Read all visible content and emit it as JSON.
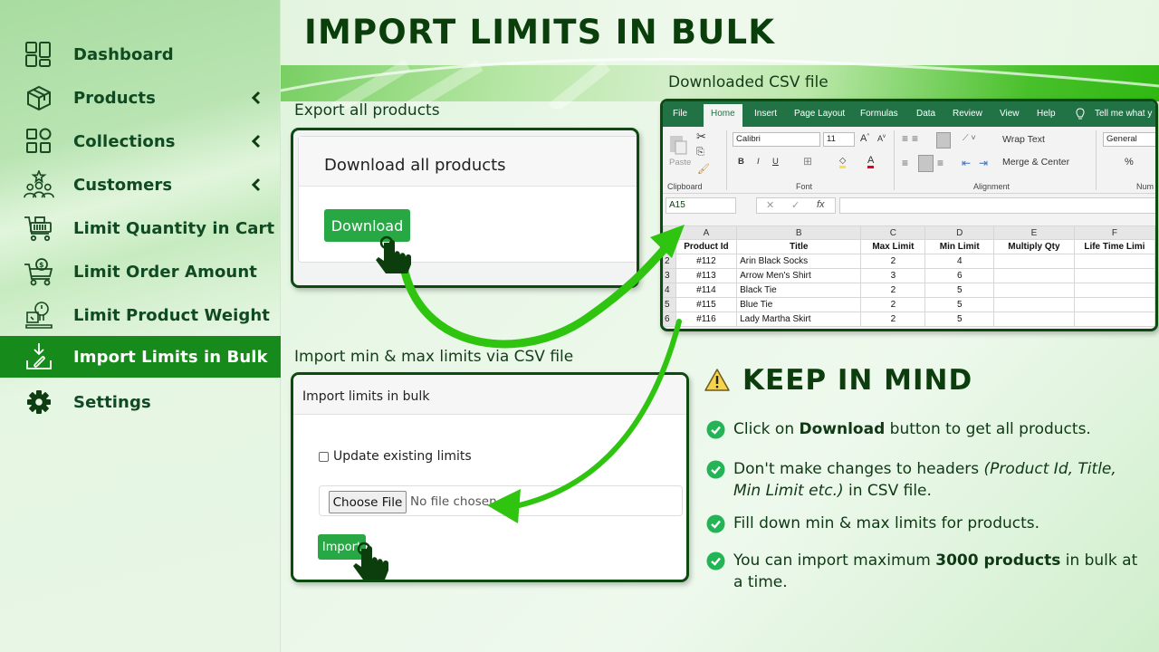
{
  "sidebar": {
    "items": [
      {
        "label": "Dashboard",
        "icon": "dashboard-icon",
        "has_chevron": false,
        "active": false
      },
      {
        "label": "Products",
        "icon": "box-icon",
        "has_chevron": true,
        "active": false
      },
      {
        "label": "Collections",
        "icon": "collections-icon",
        "has_chevron": true,
        "active": false
      },
      {
        "label": "Customers",
        "icon": "customers-icon",
        "has_chevron": true,
        "active": false
      },
      {
        "label": "Limit Quantity in Cart",
        "icon": "cart-icon",
        "has_chevron": false,
        "active": false
      },
      {
        "label": "Limit Order Amount",
        "icon": "cart-dollar-icon",
        "has_chevron": false,
        "active": false
      },
      {
        "label": "Limit Product Weight",
        "icon": "weight-scale-icon",
        "has_chevron": false,
        "active": false
      },
      {
        "label": "Import Limits in Bulk",
        "icon": "import-icon",
        "has_chevron": false,
        "active": true
      },
      {
        "label": "Settings",
        "icon": "gear-icon",
        "has_chevron": false,
        "active": false
      }
    ]
  },
  "header": {
    "title": "IMPORT LIMITS IN BULK"
  },
  "export_section": {
    "caption": "Export all products",
    "card_title": "Download all products",
    "button_label": "Download"
  },
  "csv_section": {
    "caption": "Downloaded CSV file",
    "excel": {
      "tabs": [
        "File",
        "Home",
        "Insert",
        "Page Layout",
        "Formulas",
        "Data",
        "Review",
        "View",
        "Help"
      ],
      "active_tab": "Home",
      "tell_me": "Tell me what y",
      "font_name": "Calibri",
      "font_size": "11",
      "paste_label": "Paste",
      "wrap_text": "Wrap Text",
      "merge_center": "Merge & Center",
      "number_format": "General",
      "groups": [
        "Clipboard",
        "Font",
        "Alignment",
        "Num"
      ],
      "name_box": "A15",
      "columns": [
        "A",
        "B",
        "C",
        "D",
        "E",
        "F"
      ],
      "headers": [
        "Product Id",
        "Title",
        "Max Limit",
        "Min Limit",
        "Multiply Qty",
        "Life Time Limi"
      ],
      "rows": [
        {
          "n": "2",
          "cells": [
            "#112",
            "Arin Black Socks",
            "2",
            "4",
            "",
            ""
          ]
        },
        {
          "n": "3",
          "cells": [
            "#113",
            "Arrow Men's Shirt",
            "3",
            "6",
            "",
            ""
          ]
        },
        {
          "n": "4",
          "cells": [
            "#114",
            "Black Tie",
            "2",
            "5",
            "",
            ""
          ]
        },
        {
          "n": "5",
          "cells": [
            "#115",
            "Blue Tie",
            "2",
            "5",
            "",
            ""
          ]
        },
        {
          "n": "6",
          "cells": [
            "#116",
            "Lady Martha Skirt",
            "2",
            "5",
            "",
            ""
          ]
        }
      ]
    }
  },
  "import_section": {
    "caption": "Import min & max limits via CSV file",
    "card_title": "Import limits in bulk",
    "checkbox_label": "Update existing limits",
    "checkbox_checked": false,
    "choose_file_label": "Choose File",
    "no_file_text": "No file chosen",
    "button_label": "Import"
  },
  "keep_in_mind": {
    "title": "KEEP IN MIND",
    "tips": [
      {
        "pre": "Click on ",
        "bold": "Download",
        "post": " button to get all products.",
        "italic": ""
      },
      {
        "pre": "Don't make changes to headers ",
        "italic": "(Product Id, Title, Min Limit etc.)",
        "post": " in CSV file.",
        "bold": ""
      },
      {
        "pre": "Fill down min & max limits for products.",
        "bold": "",
        "italic": "",
        "post": ""
      },
      {
        "pre": "You can import maximum ",
        "bold": "3000 products",
        "post": " in bulk at a time.",
        "italic": ""
      }
    ]
  },
  "colors": {
    "brand_green": "#168a1a",
    "button_green": "#28a745",
    "excel_green": "#217346",
    "arrow_green": "#2ec40f",
    "title_dark": "#0a3f0c"
  }
}
